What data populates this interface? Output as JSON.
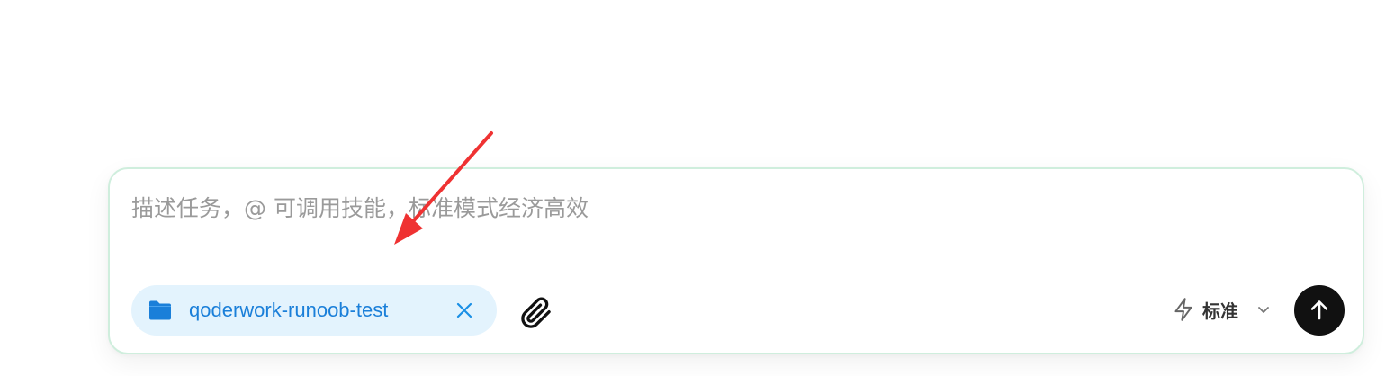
{
  "composer": {
    "placeholder": "描述任务，@ 可调用技能，标准模式经济高效",
    "value": ""
  },
  "folder_chip": {
    "label": "qoderwork-runoob-test",
    "icon": "folder-icon",
    "color": "#1a7fd9",
    "background": "#e3f3fd"
  },
  "toolbar": {
    "attach_icon": "paperclip-icon",
    "mode_icon": "bolt-icon",
    "mode_label": "标准",
    "mode_dropdown_icon": "chevron-down-icon",
    "send_icon": "arrow-up-icon"
  },
  "annotation": {
    "type": "arrow",
    "color": "#ef3232"
  }
}
